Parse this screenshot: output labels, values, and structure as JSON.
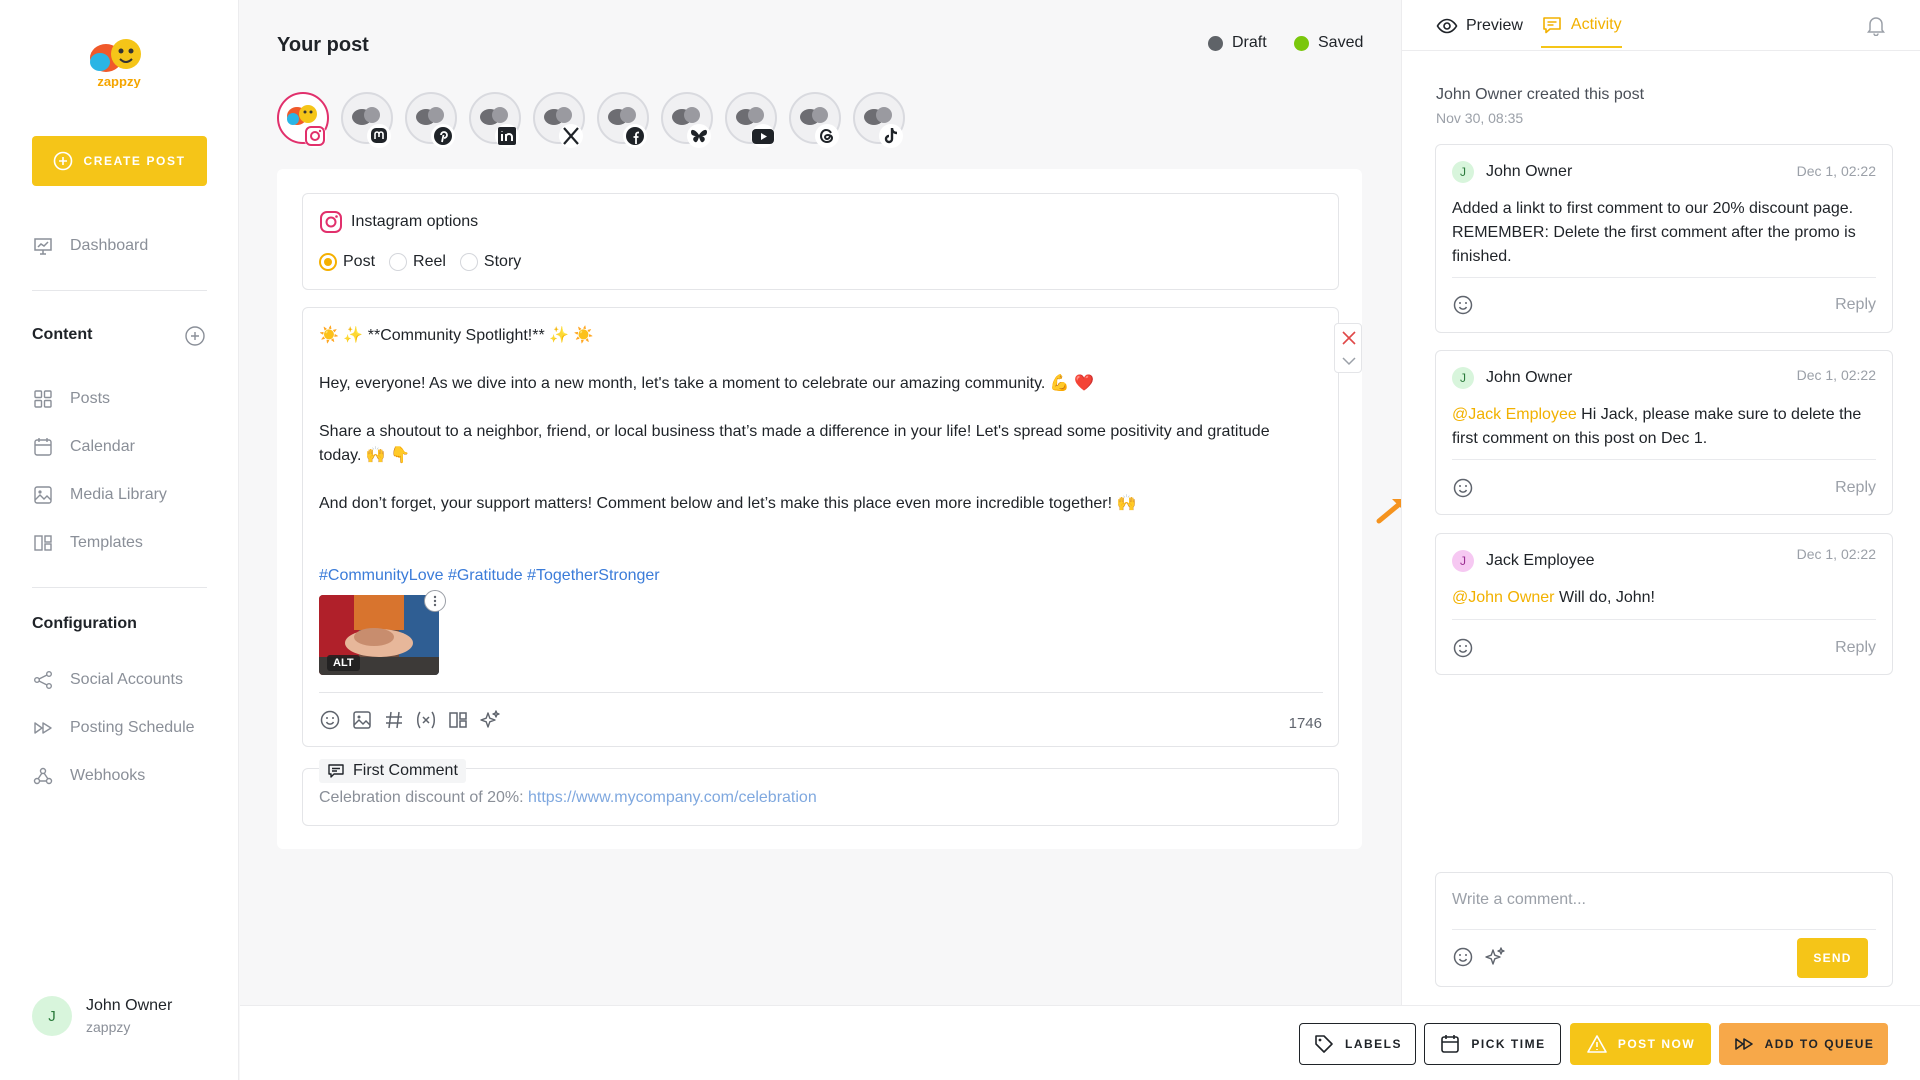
{
  "brand": {
    "name": "zappzy",
    "accent": "#f5c518"
  },
  "sidebar": {
    "create_post": "CREATE POST",
    "dashboard": "Dashboard",
    "content_title": "Content",
    "content_items": [
      "Posts",
      "Calendar",
      "Media Library",
      "Templates"
    ],
    "config_title": "Configuration",
    "config_items": [
      "Social Accounts",
      "Posting Schedule",
      "Webhooks"
    ],
    "user": {
      "initial": "J",
      "name": "John Owner",
      "org": "zappzy"
    }
  },
  "main": {
    "title": "Your post",
    "status": {
      "draft": "Draft",
      "saved": "Saved",
      "draft_color": "#5f6368",
      "saved_color": "#7ac70c"
    },
    "accounts": [
      "instagram",
      "mastodon",
      "pinterest",
      "linkedin",
      "x",
      "facebook",
      "bluesky",
      "youtube",
      "threads",
      "tiktok"
    ],
    "instagram_options": {
      "title": "Instagram options",
      "types": [
        "Post",
        "Reel",
        "Story"
      ],
      "selected": "Post"
    },
    "post": {
      "lines": [
        "☀️ ✨ **Community Spotlight!** ✨ ☀️",
        "",
        "Hey, everyone! As we dive into a new month, let's take a moment to celebrate our amazing community. 💪 ❤️",
        "",
        "Share a shoutout to a neighbor, friend, or local business that’s made a difference in your life! Let's spread some positivity and gratitude today. 🙌 👇",
        "",
        "And don’t forget, your support matters! Comment below and let’s make this place even more incredible together! 🙌",
        "",
        ""
      ],
      "hashtags": "#CommunityLove #Gratitude #TogetherStronger",
      "alt_label": "ALT",
      "char_count": "1746"
    },
    "first_comment": {
      "label": "First Comment",
      "text": "Celebration discount of 20%: ",
      "link": "https://www.mycompany.com/celebration"
    }
  },
  "activity": {
    "tabs": [
      "Preview",
      "Activity"
    ],
    "created_text": "John Owner created this post",
    "created_time": "Nov 30, 08:35",
    "comments": [
      {
        "initial": "J",
        "author": "John Owner",
        "time": "Dec 1, 02:22",
        "mention": "",
        "text": "Added a linkt to first comment to our 20% discount page. REMEMBER: Delete the first comment after the promo is finished.",
        "reply": "Reply"
      },
      {
        "initial": "J",
        "author": "John Owner",
        "time": "Dec 1, 02:22",
        "mention": "@Jack Employee",
        "text": " Hi Jack, please make sure to delete the first comment on this post on Dec 1.",
        "reply": "Reply"
      },
      {
        "initial": "J",
        "author": "Jack Employee",
        "time": "Dec 1, 02:22",
        "mention": "@John Owner",
        "text": " Will do, John!",
        "reply": "Reply"
      }
    ],
    "compose": {
      "placeholder": "Write a comment...",
      "send": "SEND"
    }
  },
  "actions": {
    "labels": "LABELS",
    "pick_time": "PICK TIME",
    "post_now": "POST NOW",
    "add_to_queue": "ADD TO QUEUE"
  }
}
